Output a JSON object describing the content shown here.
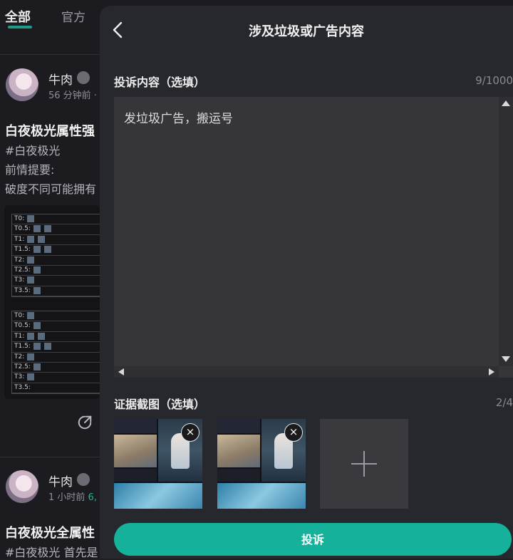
{
  "feed": {
    "tabs": [
      {
        "label": "全部"
      },
      {
        "label": "官方"
      }
    ],
    "posts": [
      {
        "username": "牛肉",
        "meta": "56 分钟前 ·",
        "title": "白夜极光属性强",
        "lines": [
          "#白夜极光",
          "前情提要:",
          "破度不同可能拥有"
        ]
      },
      {
        "username": "牛肉",
        "meta_prefix": "1 小时前 ",
        "meta_highlight": "6,",
        "title": "白夜极光全属性",
        "lines": [
          "#白夜极光 首先是"
        ]
      }
    ],
    "tier_rows_top": [
      "T0:",
      "T0.5:",
      "T1:",
      "T1.5:",
      "T2:",
      "T2.5:",
      "T3:",
      "T3.5:"
    ],
    "tier_rows_bottom": [
      "T0:",
      "T0.5:",
      "T1:",
      "T1.5:",
      "T2:",
      "T2.5:",
      "T3:",
      "T3.5:"
    ]
  },
  "dialog": {
    "title": "涉及垃圾或广告内容",
    "content_label": "投诉内容（选填）",
    "content_counter": "9/1000",
    "content_value": "发垃圾广告，搬运号",
    "evidence_label": "证据截图（选填）",
    "evidence_counter": "2/4",
    "screenshots": [
      {
        "close_icon": "×"
      },
      {
        "close_icon": "×"
      }
    ],
    "submit_label": "投诉"
  },
  "colors": {
    "accent": "#16b19b",
    "panel": "#27282d",
    "background": "#1c1c20"
  }
}
